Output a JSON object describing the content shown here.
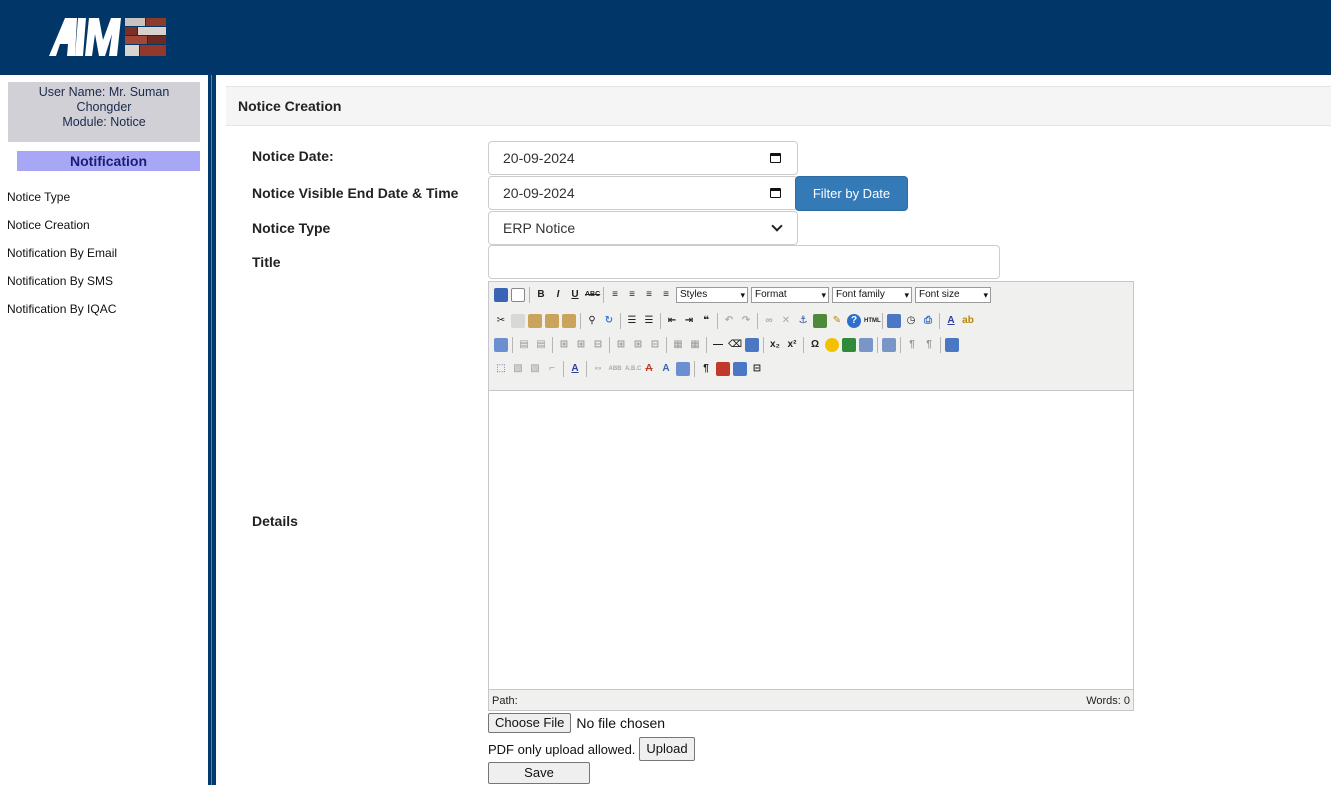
{
  "user": {
    "name_line1": "User Name: Mr. Suman",
    "name_line2": "Chongder",
    "module": "Module: Notice"
  },
  "sidebar": {
    "heading": "Notification",
    "items": [
      {
        "label": "Notice Type"
      },
      {
        "label": "Notice Creation"
      },
      {
        "label": "Notification By Email"
      },
      {
        "label": "Notification By SMS"
      },
      {
        "label": "Notification By IQAC"
      }
    ]
  },
  "page": {
    "title": "Notice Creation"
  },
  "form": {
    "notice_date_label": "Notice Date:",
    "notice_date_value": "20-09-2024",
    "end_date_label": "Notice Visible End Date  & Time",
    "end_date_value": "20-09-2024",
    "filter_button": "Filter by Date",
    "notice_type_label": "Notice Type",
    "notice_type_value": "ERP Notice",
    "title_label": "Title",
    "title_value": "",
    "details_label": "Details"
  },
  "editor": {
    "selects": [
      "Styles",
      "Format",
      "Font family",
      "Font size"
    ],
    "path_label": "Path:",
    "words_label": "Words: 0"
  },
  "upload": {
    "choose_button": "Choose File",
    "file_status": "No file chosen",
    "hint": "PDF only upload allowed.",
    "upload_button": "Upload",
    "save_button": "Save"
  },
  "colors": {
    "header_bg": "#013668",
    "sidebar_heading_bg": "#a8a7f5",
    "user_box_bg": "#d1d0d6",
    "primary_button": "#337ab7"
  }
}
